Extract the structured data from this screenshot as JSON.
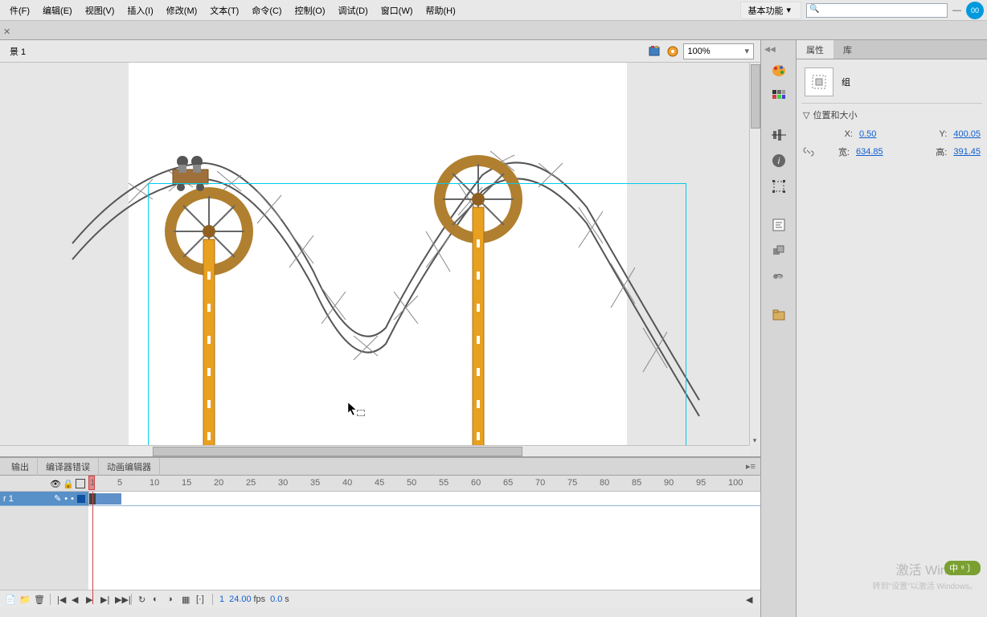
{
  "menus": {
    "file": "件(F)",
    "edit": "编辑(E)",
    "view": "视图(V)",
    "insert": "插入(I)",
    "modify": "修改(M)",
    "text": "文本(T)",
    "commands": "命令(C)",
    "control": "控制(O)",
    "debug": "调试(D)",
    "window": "窗口(W)",
    "help": "帮助(H)"
  },
  "workspace": {
    "label": "基本功能",
    "search_placeholder": ""
  },
  "cs_live": "00",
  "scene": {
    "name": "景 1",
    "zoom": "100%"
  },
  "panels": {
    "output": "输出",
    "compiler_errors": "编译器错误",
    "motion_editor": "动画编辑器"
  },
  "timeline": {
    "frame_numbers": [
      "1",
      "5",
      "10",
      "15",
      "20",
      "25",
      "30",
      "35",
      "40",
      "45",
      "50",
      "55",
      "60",
      "65",
      "70",
      "75",
      "80",
      "85",
      "90",
      "95",
      "100"
    ],
    "layer_name": "r 1",
    "current_frame": "1",
    "fps_value": "24.00",
    "fps_unit": "fps",
    "time_value": "0.0",
    "time_unit": "s"
  },
  "properties": {
    "tab_props": "属性",
    "tab_library": "库",
    "instance_type": "组",
    "section_pos": "位置和大小",
    "x_label": "X:",
    "x_value": "0.50",
    "y_label": "Y:",
    "y_value": "400.05",
    "w_label": "宽:",
    "w_value": "634.85",
    "h_label": "高:",
    "h_value": "391.45"
  },
  "watermark": {
    "main": "激活 Windows",
    "sub": "转到\"设置\"以激活 Windows。"
  },
  "ime": "中 ⁹ 〕"
}
